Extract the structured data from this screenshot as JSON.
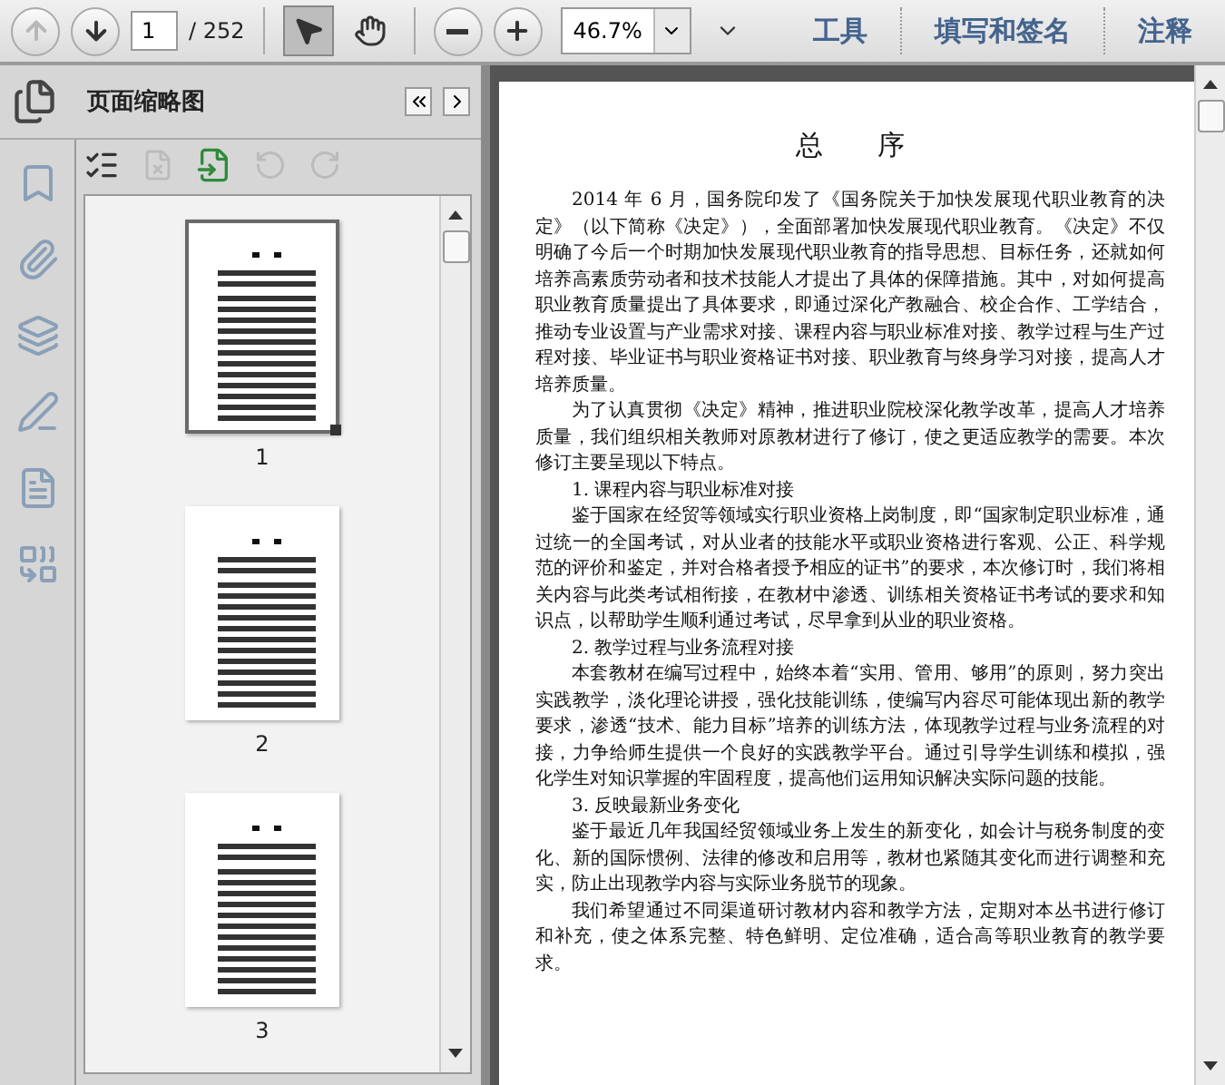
{
  "toolbar": {
    "page_input": "1",
    "page_total": "/ 252",
    "zoom": "46.7%",
    "links": [
      "工具",
      "填写和签名",
      "注释"
    ]
  },
  "sidebar": {
    "title": "页面缩略图",
    "thumbnails": [
      {
        "label": "1",
        "selected": true
      },
      {
        "label": "2",
        "selected": false
      },
      {
        "label": "3",
        "selected": false
      }
    ]
  },
  "document": {
    "title": "总　　序",
    "blocks": [
      {
        "kind": "paragraph",
        "text": "2014 年 6 月，国务院印发了《国务院关于加快发展现代职业教育的决定》（以下简称《决定》），全面部署加快发展现代职业教育。《决定》不仅明确了今后一个时期加快发展现代职业教育的指导思想、目标任务，还就如何培养高素质劳动者和技术技能人才提出了具体的保障措施。其中，对如何提高职业教育质量提出了具体要求，即通过深化产教融合、校企合作、工学结合，推动专业设置与产业需求对接、课程内容与职业标准对接、教学过程与生产过程对接、毕业证书与职业资格证书对接、职业教育与终身学习对接，提高人才培养质量。"
      },
      {
        "kind": "paragraph",
        "text": "为了认真贯彻《决定》精神，推进职业院校深化教学改革，提高人才培养质量，我们组织相关教师对原教材进行了修订，使之更适应教学的需要。本次修订主要呈现以下特点。"
      },
      {
        "kind": "heading",
        "text": "1. 课程内容与职业标准对接"
      },
      {
        "kind": "paragraph",
        "text": "鉴于国家在经贸等领域实行职业资格上岗制度，即“国家制定职业标准，通过统一的全国考试，对从业者的技能水平或职业资格进行客观、公正、科学规范的评价和鉴定，并对合格者授予相应的证书”的要求，本次修订时，我们将相关内容与此类考试相衔接，在教材中渗透、训练相关资格证书考试的要求和知识点，以帮助学生顺利通过考试，尽早拿到从业的职业资格。"
      },
      {
        "kind": "heading",
        "text": "2. 教学过程与业务流程对接"
      },
      {
        "kind": "paragraph",
        "text": "本套教材在编写过程中，始终本着“实用、管用、够用”的原则，努力突出实践教学，淡化理论讲授，强化技能训练，使编写内容尽可能体现出新的教学要求，渗透“技术、能力目标”培养的训练方法，体现教学过程与业务流程的对接，力争给师生提供一个良好的实践教学平台。通过引导学生训练和模拟，强化学生对知识掌握的牢固程度，提高他们运用知识解决实际问题的技能。"
      },
      {
        "kind": "heading",
        "text": "3. 反映最新业务变化"
      },
      {
        "kind": "paragraph",
        "text": "鉴于最近几年我国经贸领域业务上发生的新变化，如会计与税务制度的变化、新的国际惯例、法律的修改和启用等，教材也紧随其变化而进行调整和充实，防止出现教学内容与实际业务脱节的现象。"
      },
      {
        "kind": "paragraph",
        "text": "我们希望通过不同渠道研讨教材内容和教学方法，定期对本丛书进行修订和补充，使之体系完整、特色鲜明、定位准确，适合高等职业教育的教学要求。"
      }
    ]
  }
}
